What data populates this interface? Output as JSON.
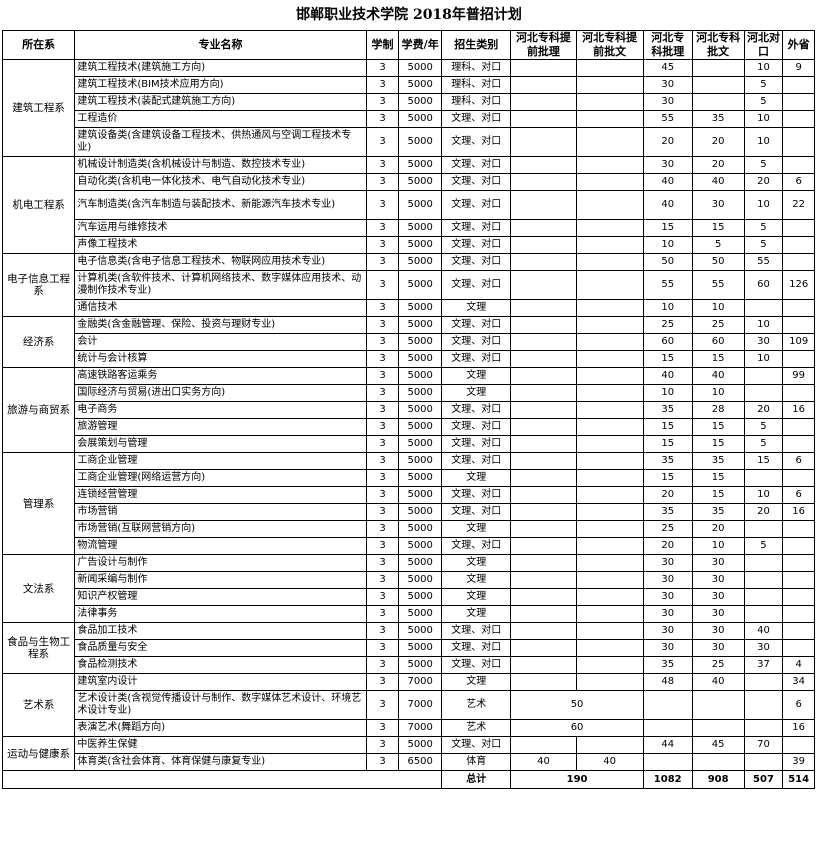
{
  "title": "邯郸职业技术学院 2018年普招计划",
  "headers": [
    "所在系",
    "专业名称",
    "学制",
    "学费/年",
    "招生类别",
    "河北专科提前批理",
    "河北专科提前批文",
    "河北专科批理",
    "河北专科批文",
    "河北对口",
    "外省"
  ],
  "depts": [
    {
      "name": "建筑工程系",
      "rows": [
        {
          "major": "建筑工程技术(建筑施工方向)",
          "years": "3",
          "fee": "5000",
          "cat": "理科、对口",
          "li": "45",
          "wen": "",
          "dk": "10",
          "ws": "9"
        },
        {
          "major": "建筑工程技术(BIM技术应用方向)",
          "years": "3",
          "fee": "5000",
          "cat": "理科、对口",
          "li": "30",
          "wen": "",
          "dk": "5",
          "ws": ""
        },
        {
          "major": "建筑工程技术(装配式建筑施工方向)",
          "years": "3",
          "fee": "5000",
          "cat": "理科、对口",
          "li": "30",
          "wen": "",
          "dk": "5",
          "ws": ""
        },
        {
          "major": "工程造价",
          "years": "3",
          "fee": "5000",
          "cat": "文理、对口",
          "li": "55",
          "wen": "35",
          "dk": "10",
          "ws": ""
        },
        {
          "major": "建筑设备类(含建筑设备工程技术、供热通风与空调工程技术专业)",
          "years": "3",
          "fee": "5000",
          "cat": "文理、对口",
          "li": "20",
          "wen": "20",
          "dk": "10",
          "ws": ""
        }
      ]
    },
    {
      "name": "机电工程系",
      "rows": [
        {
          "major": "机械设计制造类(含机械设计与制造、数控技术专业)",
          "years": "3",
          "fee": "5000",
          "cat": "文理、对口",
          "li": "30",
          "wen": "20",
          "dk": "5",
          "ws": ""
        },
        {
          "major": "自动化类(含机电一体化技术、电气自动化技术专业)",
          "years": "3",
          "fee": "5000",
          "cat": "文理、对口",
          "li": "40",
          "wen": "40",
          "dk": "20",
          "ws": "6"
        },
        {
          "major": "汽车制造类(含汽车制造与装配技术、新能源汽车技术专业)",
          "years": "3",
          "fee": "5000",
          "cat": "文理、对口",
          "li": "40",
          "wen": "30",
          "dk": "10",
          "ws": "22"
        },
        {
          "major": "汽车运用与维修技术",
          "years": "3",
          "fee": "5000",
          "cat": "文理、对口",
          "li": "15",
          "wen": "15",
          "dk": "5",
          "ws": ""
        },
        {
          "major": "声像工程技术",
          "years": "3",
          "fee": "5000",
          "cat": "文理、对口",
          "li": "10",
          "wen": "5",
          "dk": "5",
          "ws": ""
        }
      ]
    },
    {
      "name": "电子信息工程系",
      "rows": [
        {
          "major": "电子信息类(含电子信息工程技术、物联网应用技术专业)",
          "years": "3",
          "fee": "5000",
          "cat": "文理、对口",
          "li": "50",
          "wen": "50",
          "dk": "55",
          "ws": ""
        },
        {
          "major": "计算机类(含软件技术、计算机网络技术、数字媒体应用技术、动漫制作技术专业)",
          "years": "3",
          "fee": "5000",
          "cat": "文理、对口",
          "li": "55",
          "wen": "55",
          "dk": "60",
          "ws": "126"
        },
        {
          "major": "通信技术",
          "years": "3",
          "fee": "5000",
          "cat": "文理",
          "li": "10",
          "wen": "10",
          "dk": "",
          "ws": ""
        }
      ]
    },
    {
      "name": "经济系",
      "rows": [
        {
          "major": "金融类(含金融管理、保险、投资与理财专业)",
          "years": "3",
          "fee": "5000",
          "cat": "文理、对口",
          "li": "25",
          "wen": "25",
          "dk": "10",
          "ws": ""
        },
        {
          "major": "会计",
          "years": "3",
          "fee": "5000",
          "cat": "文理、对口",
          "li": "60",
          "wen": "60",
          "dk": "30",
          "ws": "109"
        },
        {
          "major": "统计与会计核算",
          "years": "3",
          "fee": "5000",
          "cat": "文理、对口",
          "li": "15",
          "wen": "15",
          "dk": "10",
          "ws": ""
        }
      ]
    },
    {
      "name": "旅游与商贸系",
      "rows": [
        {
          "major": "高速铁路客运乘务",
          "years": "3",
          "fee": "5000",
          "cat": "文理",
          "li": "40",
          "wen": "40",
          "dk": "",
          "ws": "99"
        },
        {
          "major": "国际经济与贸易(进出口实务方向)",
          "years": "3",
          "fee": "5000",
          "cat": "文理",
          "li": "10",
          "wen": "10",
          "dk": "",
          "ws": ""
        },
        {
          "major": "电子商务",
          "years": "3",
          "fee": "5000",
          "cat": "文理、对口",
          "li": "35",
          "wen": "28",
          "dk": "20",
          "ws": "16"
        },
        {
          "major": "旅游管理",
          "years": "3",
          "fee": "5000",
          "cat": "文理、对口",
          "li": "15",
          "wen": "15",
          "dk": "5",
          "ws": ""
        },
        {
          "major": "会展策划与管理",
          "years": "3",
          "fee": "5000",
          "cat": "文理、对口",
          "li": "15",
          "wen": "15",
          "dk": "5",
          "ws": ""
        }
      ]
    },
    {
      "name": "管理系",
      "rows": [
        {
          "major": "工商企业管理",
          "years": "3",
          "fee": "5000",
          "cat": "文理、对口",
          "li": "35",
          "wen": "35",
          "dk": "15",
          "ws": "6"
        },
        {
          "major": "工商企业管理(网络运营方向)",
          "years": "3",
          "fee": "5000",
          "cat": "文理",
          "li": "15",
          "wen": "15",
          "dk": "",
          "ws": ""
        },
        {
          "major": "连锁经营管理",
          "years": "3",
          "fee": "5000",
          "cat": "文理、对口",
          "li": "20",
          "wen": "15",
          "dk": "10",
          "ws": "6"
        },
        {
          "major": "市场营销",
          "years": "3",
          "fee": "5000",
          "cat": "文理、对口",
          "li": "35",
          "wen": "35",
          "dk": "20",
          "ws": "16"
        },
        {
          "major": "市场营销(互联网营销方向)",
          "years": "3",
          "fee": "5000",
          "cat": "文理",
          "li": "25",
          "wen": "20",
          "dk": "",
          "ws": ""
        },
        {
          "major": "物流管理",
          "years": "3",
          "fee": "5000",
          "cat": "文理、对口",
          "li": "20",
          "wen": "10",
          "dk": "5",
          "ws": ""
        }
      ]
    },
    {
      "name": "文法系",
      "rows": [
        {
          "major": "广告设计与制作",
          "years": "3",
          "fee": "5000",
          "cat": "文理",
          "li": "30",
          "wen": "30",
          "dk": "",
          "ws": ""
        },
        {
          "major": "新闻采编与制作",
          "years": "3",
          "fee": "5000",
          "cat": "文理",
          "li": "30",
          "wen": "30",
          "dk": "",
          "ws": ""
        },
        {
          "major": "知识产权管理",
          "years": "3",
          "fee": "5000",
          "cat": "文理",
          "li": "30",
          "wen": "30",
          "dk": "",
          "ws": ""
        },
        {
          "major": "法律事务",
          "years": "3",
          "fee": "5000",
          "cat": "文理",
          "li": "30",
          "wen": "30",
          "dk": "",
          "ws": ""
        }
      ]
    },
    {
      "name": "食品与生物工程系",
      "rows": [
        {
          "major": "食品加工技术",
          "years": "3",
          "fee": "5000",
          "cat": "文理、对口",
          "li": "30",
          "wen": "30",
          "dk": "40",
          "ws": ""
        },
        {
          "major": "食品质量与安全",
          "years": "3",
          "fee": "5000",
          "cat": "文理、对口",
          "li": "30",
          "wen": "30",
          "dk": "30",
          "ws": ""
        },
        {
          "major": "食品检测技术",
          "years": "3",
          "fee": "5000",
          "cat": "文理、对口",
          "li": "35",
          "wen": "25",
          "dk": "37",
          "ws": "4"
        }
      ]
    },
    {
      "name": "艺术系",
      "rows": [
        {
          "major": "建筑室内设计",
          "years": "3",
          "fee": "7000",
          "cat": "文理",
          "li": "48",
          "wen": "40",
          "dk": "",
          "ws": "34"
        },
        {
          "major": "艺术设计类(含视觉传播设计与制作、数字媒体艺术设计、环境艺术设计专业)",
          "years": "3",
          "fee": "7000",
          "cat": "艺术",
          "early": "50",
          "li": "",
          "wen": "",
          "dk": "",
          "ws": "6"
        },
        {
          "major": "表演艺术(舞蹈方向)",
          "years": "3",
          "fee": "7000",
          "cat": "艺术",
          "early": "60",
          "li": "",
          "wen": "",
          "dk": "",
          "ws": "16"
        }
      ]
    },
    {
      "name": "运动与健康系",
      "rows": [
        {
          "major": "中医养生保健",
          "years": "3",
          "fee": "5000",
          "cat": "文理、对口",
          "li": "44",
          "wen": "45",
          "dk": "70",
          "ws": ""
        },
        {
          "major": "体育类(含社会体育、体育保健与康复专业)",
          "years": "3",
          "fee": "6500",
          "cat": "体育",
          "tq_li": "40",
          "tq_wen": "40",
          "li": "",
          "wen": "",
          "dk": "",
          "ws": "39"
        }
      ]
    }
  ],
  "total": {
    "label": "总计",
    "early": "190",
    "li": "1082",
    "wen": "908",
    "dk": "507",
    "ws": "514"
  }
}
